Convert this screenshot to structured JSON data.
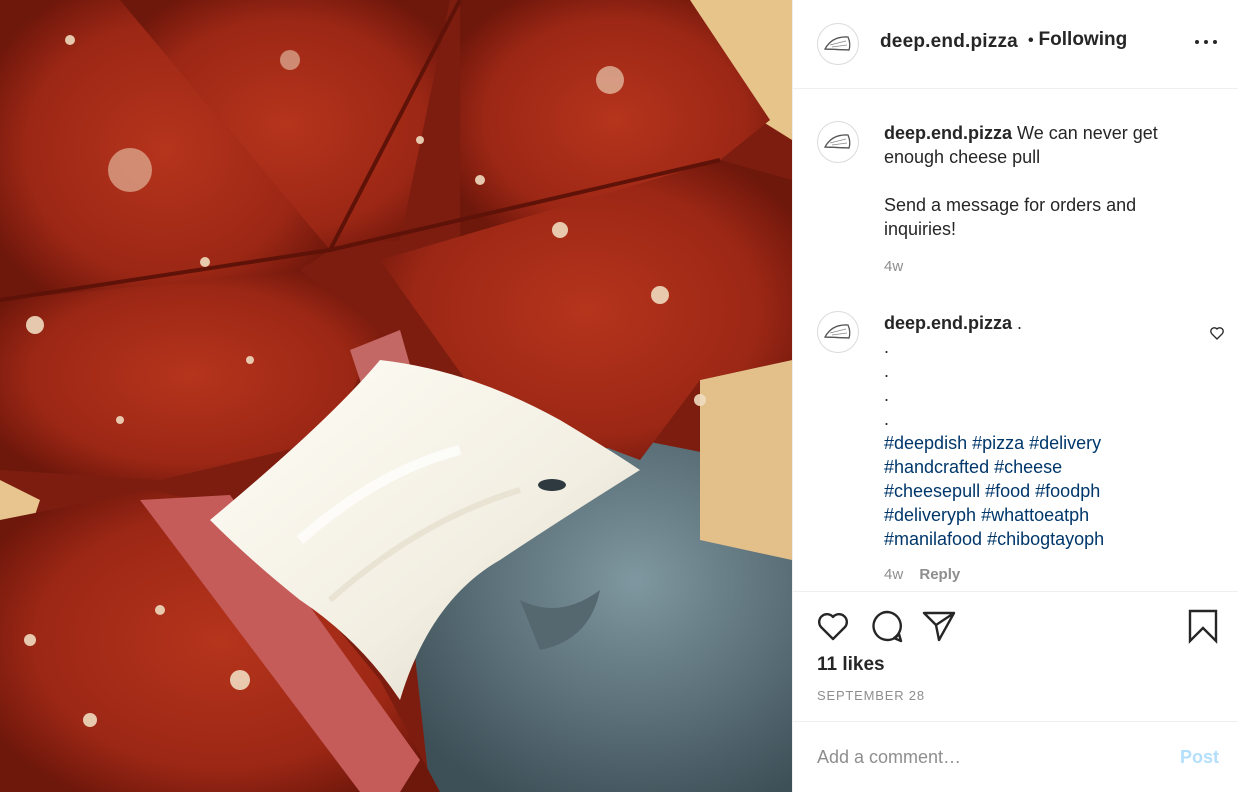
{
  "photo": {
    "subject": "deep dish pizza cheese pull"
  },
  "header": {
    "username": "deep.end.pizza",
    "separator": "•",
    "follow_status": "Following",
    "more_icon": "more-horizontal-icon"
  },
  "caption": {
    "username": "deep.end.pizza",
    "line1": "We can never get enough cheese pull",
    "line2": "Send a message for orders and inquiries!",
    "age": "4w"
  },
  "comment": {
    "username": "deep.end.pizza",
    "first": ".",
    "dots": [
      ".",
      ".",
      ".",
      "."
    ],
    "hashtags": [
      [
        "#deepdish",
        "#pizza",
        "#delivery"
      ],
      [
        "#handcrafted",
        "#cheese"
      ],
      [
        "#cheesepull",
        "#food",
        "#foodph"
      ],
      [
        "#deliveryph",
        "#whattoeatph"
      ],
      [
        "#manilafood",
        "#chibogtayoph"
      ]
    ],
    "age": "4w",
    "reply_label": "Reply"
  },
  "likes": "11 likes",
  "date": "SEPTEMBER 28",
  "add_comment": {
    "placeholder": "Add a comment…",
    "post_label": "Post"
  },
  "colors": {
    "hashtag": "#00376b",
    "meta": "#8e8e8e",
    "post_disabled": "#b2dffc"
  }
}
